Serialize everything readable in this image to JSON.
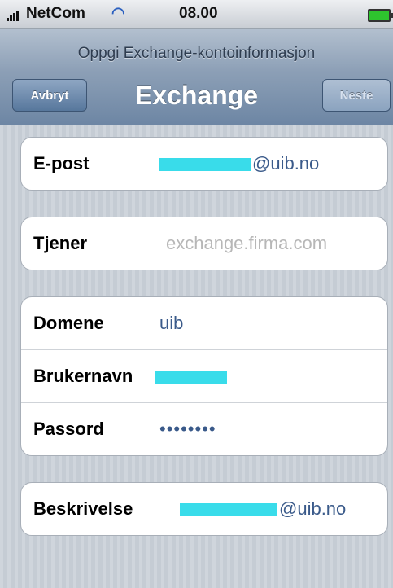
{
  "status_bar": {
    "carrier": "NetCom",
    "time": "08.00",
    "wifi_icon": "wifi-icon",
    "battery_icon": "battery-icon"
  },
  "nav": {
    "prompt": "Oppgi Exchange-kontoinformasjon",
    "title": "Exchange",
    "cancel_label": "Avbryt",
    "next_label": "Neste"
  },
  "form": {
    "email": {
      "label": "E-post",
      "value": "@uib.no"
    },
    "server": {
      "label": "Tjener",
      "placeholder": "exchange.firma.com"
    },
    "domain": {
      "label": "Domene",
      "value": "uib"
    },
    "username": {
      "label": "Brukernavn",
      "value": ""
    },
    "password": {
      "label": "Passord",
      "value": "••••••••"
    },
    "description": {
      "label": "Beskrivelse",
      "value": "@uib.no"
    }
  },
  "colors": {
    "accent_value": "#3a5a8a",
    "redaction": "#39dcea",
    "background": "#c5ccd4"
  }
}
